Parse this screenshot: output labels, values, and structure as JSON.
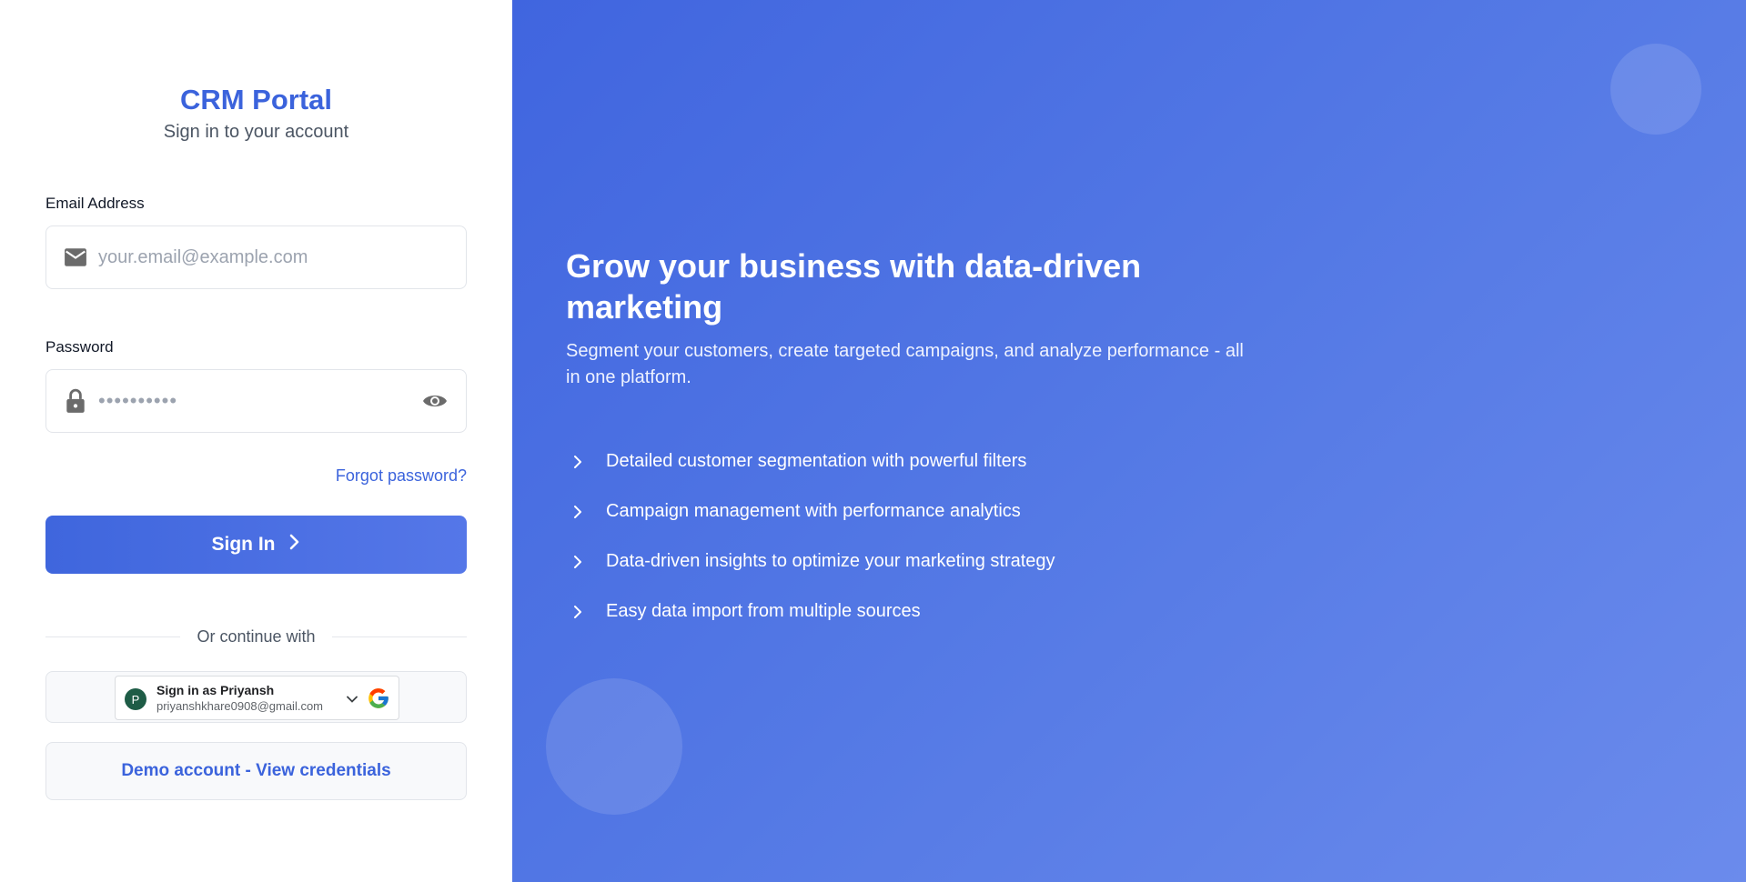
{
  "brand": "CRM Portal",
  "subtitle": "Sign in to your account",
  "email": {
    "label": "Email Address",
    "placeholder": "your.email@example.com"
  },
  "password": {
    "label": "Password",
    "masked_value": "••••••••••"
  },
  "forgot_link": "Forgot password?",
  "signin_button": "Sign In",
  "divider_text": "Or continue with",
  "google": {
    "title": "Sign in as Priyansh",
    "email": "priyanshkhare0908@gmail.com",
    "avatar_letter": "P"
  },
  "demo_button": "Demo account - View credentials",
  "hero": {
    "title": "Grow your business with data-driven marketing",
    "description": "Segment your customers, create targeted campaigns, and analyze performance - all in one platform.",
    "features": [
      "Detailed customer segmentation with powerful filters",
      "Campaign management with performance analytics",
      "Data-driven insights to optimize your marketing strategy",
      "Easy data import from multiple sources"
    ]
  },
  "colors": {
    "accent": "#3b63dc",
    "panel_start": "#4065df",
    "panel_end": "#6b8bec"
  },
  "icons": {
    "email": "mail-icon",
    "password": "lock-icon",
    "toggle": "eye-icon",
    "feature": "chevron-right-icon"
  }
}
